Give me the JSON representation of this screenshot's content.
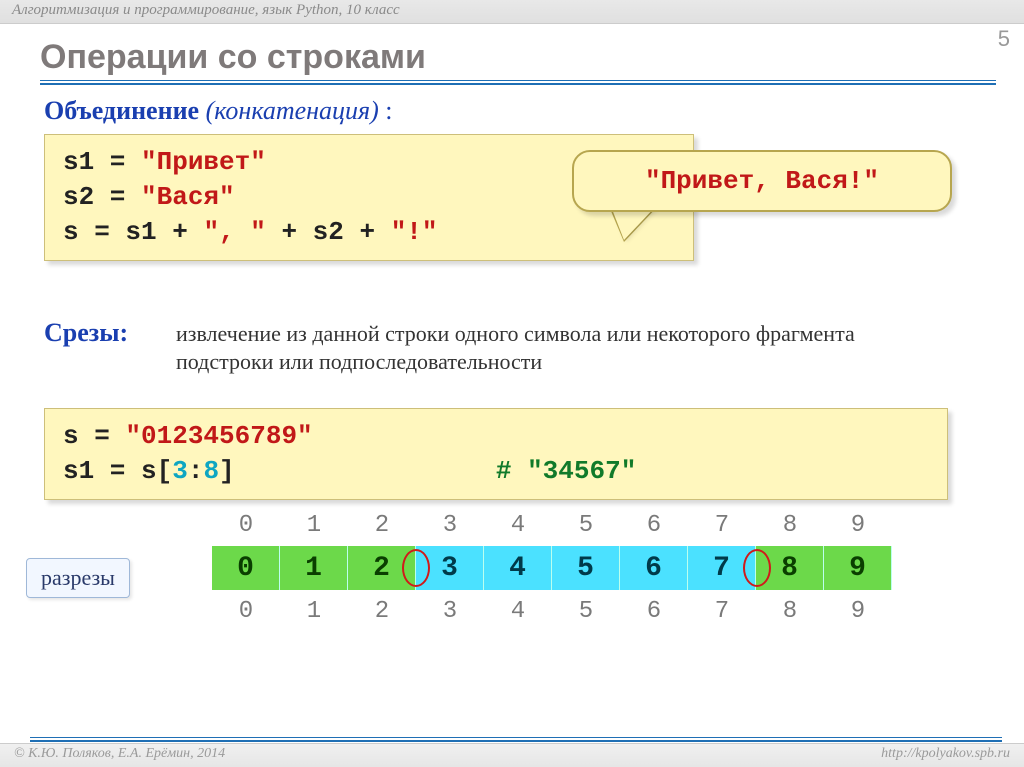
{
  "topbar": "Алгоритмизация и программирование, язык Python, 10 класс",
  "page_number": "5",
  "title": "Операции со строками",
  "concat": {
    "label": "Объединение",
    "paren": "(конкатенация)",
    "colon": " :",
    "code": {
      "l1a": "s1 = ",
      "l1b": "\"Привет\"",
      "l2a": "s2 = ",
      "l2b": "\"Вася\"",
      "l3a": "s  = s1 + ",
      "l3b": "\", \"",
      "l3c": " + s2 + ",
      "l3d": "\"!\""
    },
    "result": "\"Привет, Вася!\""
  },
  "slices": {
    "label": "Срезы:",
    "desc": "извлечение из данной строки одного символа или некоторого фрагмента подстроки или подпоследовательности",
    "code": {
      "l1a": "s = ",
      "l1b": "\"0123456789\"",
      "l2a": "s1 = s[",
      "l2n1": "3",
      "l2b": ":",
      "l2n2": "8",
      "l2c": "]",
      "l2comment": "# \"34567\""
    },
    "indices_top": [
      "0",
      "1",
      "2",
      "3",
      "4",
      "5",
      "6",
      "7",
      "8",
      "9"
    ],
    "cells": [
      "0",
      "1",
      "2",
      "3",
      "4",
      "5",
      "6",
      "7",
      "8",
      "9"
    ],
    "cell_colors": [
      "green",
      "green",
      "green",
      "cyan",
      "cyan",
      "cyan",
      "cyan",
      "cyan",
      "green",
      "green"
    ],
    "indices_bot": [
      "0",
      "1",
      "2",
      "3",
      "4",
      "5",
      "6",
      "7",
      "8",
      "9"
    ],
    "cut_label": "разрезы"
  },
  "footer": {
    "left": "© К.Ю. Поляков, Е.А. Ерёмин, 2014",
    "right": "http://kpolyakov.spb.ru"
  }
}
